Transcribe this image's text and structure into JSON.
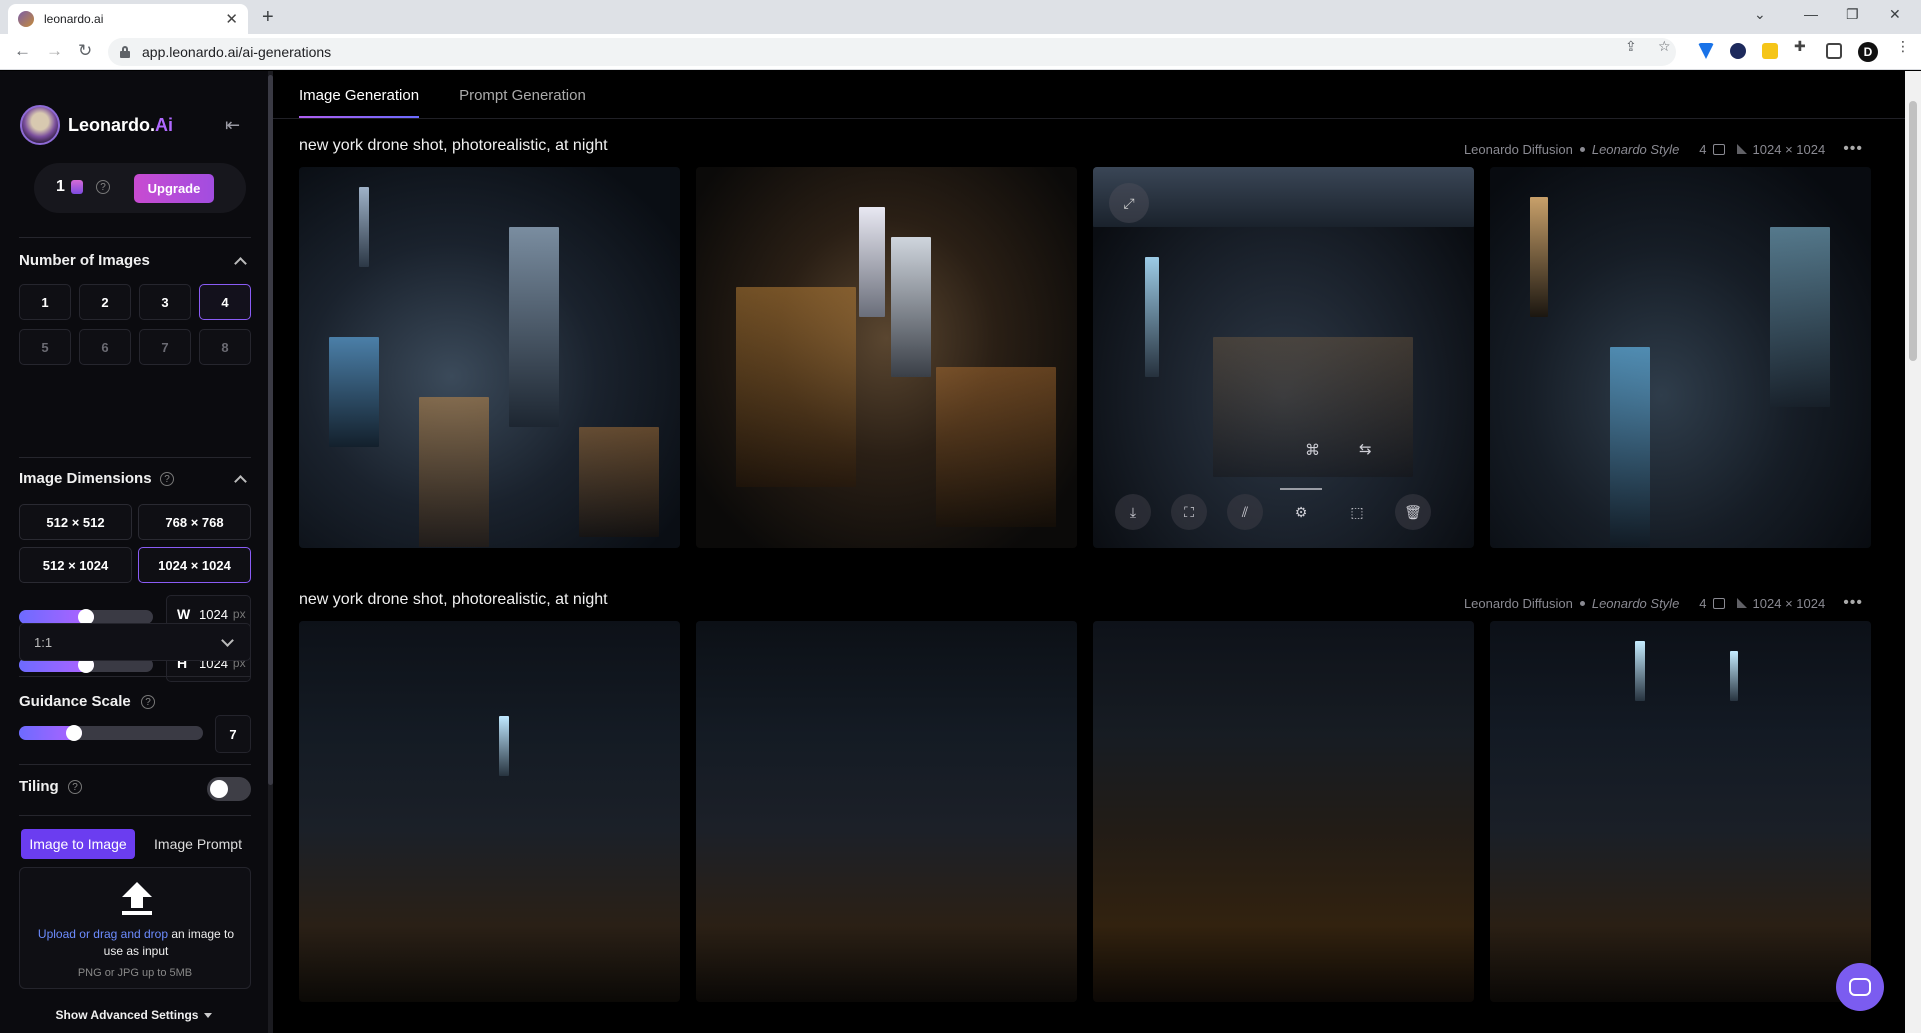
{
  "browser": {
    "tab_title": "leonardo.ai",
    "url": "app.leonardo.ai/ai-generations",
    "profile_initial": "D"
  },
  "sidebar": {
    "brand": "Leonardo.",
    "brand_suffix": "Ai",
    "credits": "1",
    "upgrade_label": "Upgrade",
    "number_of_images": {
      "title": "Number of Images",
      "options": [
        "1",
        "2",
        "3",
        "4",
        "5",
        "6",
        "7",
        "8"
      ],
      "selected": "4"
    },
    "image_dimensions": {
      "title": "Image Dimensions",
      "options": [
        "512 × 512",
        "768 × 768",
        "512 × 1024",
        "1024 × 1024"
      ],
      "selected": "1024 × 1024",
      "width_label": "W",
      "width_value": "1024",
      "height_label": "H",
      "height_value": "1024",
      "unit": "px",
      "width_slider_fraction": 0.5,
      "height_slider_fraction": 0.5,
      "aspect_ratio": "1:1"
    },
    "guidance_scale": {
      "title": "Guidance Scale",
      "value": "7",
      "slider_fraction": 0.3
    },
    "tiling": {
      "title": "Tiling",
      "enabled": false
    },
    "input_tabs": {
      "active": "Image to Image",
      "other": "Image Prompt"
    },
    "upload": {
      "link_text": "Upload or drag and drop",
      "rest_text": " an image to use as input",
      "hint": "PNG or JPG up to 5MB"
    },
    "advanced_label": "Show Advanced Settings"
  },
  "main": {
    "tabs": [
      "Image Generation",
      "Prompt Generation"
    ],
    "active_tab": "Image Generation",
    "generations": [
      {
        "prompt": "new york drone shot, photorealistic, at night",
        "model": "Leonardo Diffusion",
        "style": "Leonardo Style",
        "count": "4",
        "size": "1024 × 1024"
      },
      {
        "prompt": "new york drone shot, photorealistic, at night",
        "model": "Leonardo Diffusion",
        "style": "Leonardo Style",
        "count": "4",
        "size": "1024 × 1024"
      }
    ]
  },
  "colors": {
    "accent": "#8a5cf6",
    "upgrade_gradient_start": "#c84bd1",
    "link": "#6d8cff"
  },
  "icons": [
    "back-icon",
    "forward-icon",
    "reload-icon",
    "lock-icon",
    "share-icon",
    "star-icon",
    "extensions-icon",
    "download-icon",
    "expand-icon",
    "remove-background-icon",
    "upscale-icon",
    "crop-icon",
    "delete-icon",
    "chat-icon"
  ]
}
